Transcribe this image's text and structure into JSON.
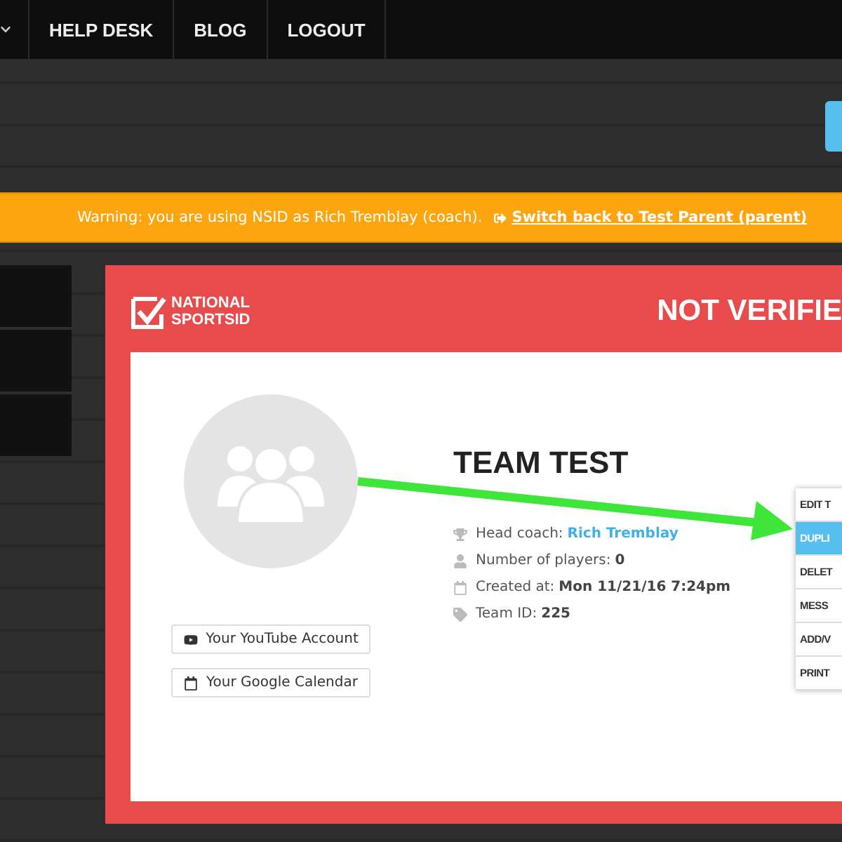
{
  "nav": {
    "items": [
      {
        "label": "HELP DESK"
      },
      {
        "label": "BLOG"
      },
      {
        "label": "LOGOUT"
      }
    ]
  },
  "warning": {
    "text": "Warning: you are using NSID as Rich Tremblay (coach).",
    "link": "Switch back to Test Parent (parent)"
  },
  "card": {
    "logo": [
      "NATIONAL",
      "SPORTSID"
    ],
    "status": "NOT VERIFIE",
    "team": {
      "name": "TEAM TEST",
      "details": [
        {
          "kind": "trophy",
          "label": "Head coach:",
          "value": "Rich Tremblay",
          "link": true
        },
        {
          "kind": "user",
          "label": "Number of players:",
          "value": "0",
          "link": false
        },
        {
          "kind": "calendar",
          "label": "Created at:",
          "value": "Mon 11/21/16 7:24pm",
          "link": false
        },
        {
          "kind": "tag",
          "label": "Team ID:",
          "value": "225",
          "link": false
        }
      ]
    },
    "buttons": [
      {
        "kind": "youtube",
        "label": "Your YouTube Account"
      },
      {
        "kind": "calendar",
        "label": "Your Google Calendar"
      }
    ],
    "menu": [
      {
        "label": "EDIT T",
        "selected": false
      },
      {
        "label": "DUPLI",
        "selected": true
      },
      {
        "label": "DELET",
        "selected": false
      },
      {
        "label": "MESS",
        "selected": false
      },
      {
        "label": "ADD/V",
        "selected": false
      },
      {
        "label": "PRINT",
        "selected": false
      }
    ]
  }
}
